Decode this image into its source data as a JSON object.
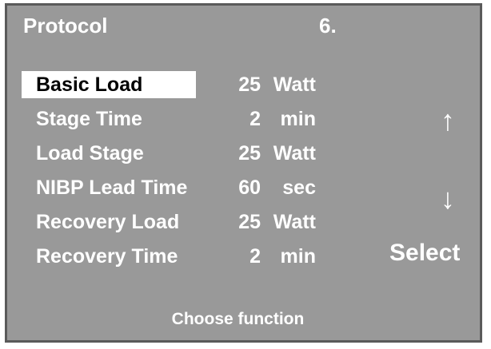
{
  "header": {
    "title": "Protocol",
    "page": "6."
  },
  "rows": [
    {
      "label": "Basic Load",
      "value": "25",
      "unit": "Watt",
      "selected": true
    },
    {
      "label": "Stage Time",
      "value": "2",
      "unit": "min",
      "selected": false
    },
    {
      "label": "Load Stage",
      "value": "25",
      "unit": "Watt",
      "selected": false
    },
    {
      "label": "NIBP Lead Time",
      "value": "60",
      "unit": "sec",
      "selected": false
    },
    {
      "label": "Recovery Load",
      "value": "25",
      "unit": "Watt",
      "selected": false
    },
    {
      "label": "Recovery Time",
      "value": "2",
      "unit": "min",
      "selected": false
    }
  ],
  "controls": {
    "up_arrow": "↑",
    "down_arrow": "↓",
    "select_label": "Select"
  },
  "footer": {
    "hint": "Choose function"
  },
  "colors": {
    "screen_bg": "#999999",
    "text": "#ffffff",
    "highlight_bg": "#ffffff",
    "highlight_text": "#000000"
  }
}
